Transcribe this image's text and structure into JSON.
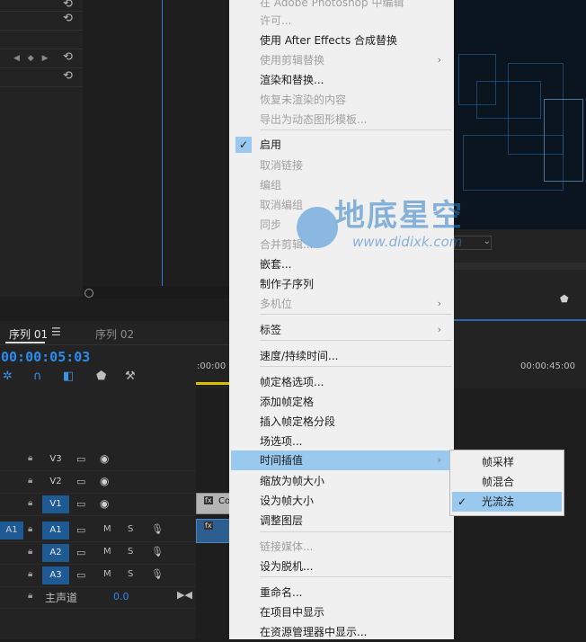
{
  "effect_controls": {
    "reset_glyph": "⟲",
    "keyframe_nav": "◀ ◆ ▶"
  },
  "monitor": {
    "zoom_value": "⌄",
    "marker_glyph": "⬟"
  },
  "timeline": {
    "tabs": [
      {
        "label": "序列 01"
      },
      {
        "label": "序列 02"
      }
    ],
    "tab_menu_glyph": "☰",
    "timecode": "00:00:05:03",
    "ruler": {
      "start": ":00:00",
      "mid": "00:00:45:00"
    },
    "tracks": {
      "video": [
        {
          "name": "V3",
          "enabled": false
        },
        {
          "name": "V2",
          "enabled": false
        },
        {
          "name": "V1",
          "enabled": true
        }
      ],
      "audio": [
        {
          "name": "A1",
          "source": "A1",
          "enabled": true
        },
        {
          "name": "A2",
          "source": "",
          "enabled": true
        },
        {
          "name": "A3",
          "source": "",
          "enabled": true
        }
      ],
      "mute_label": "M",
      "solo_label": "S"
    },
    "master": {
      "label": "主声道",
      "value": "0.0"
    },
    "clip_v1_label": "Co",
    "fx_badge": "fx"
  },
  "context_menu": {
    "items": [
      {
        "label": "在 Adobe Photoshop 中编辑",
        "disabled": true
      },
      {
        "label": "许可...",
        "disabled": true
      },
      {
        "label": "使用 After Effects 合成替换",
        "disabled": false
      },
      {
        "label": "使用剪辑替换",
        "disabled": true,
        "submenu": true
      },
      {
        "label": "渲染和替换...",
        "disabled": false
      },
      {
        "label": "恢复未渲染的内容",
        "disabled": true
      },
      {
        "label": "导出为动态图形模板...",
        "disabled": true
      },
      {
        "label": "启用",
        "disabled": false,
        "checked": true
      },
      {
        "label": "取消链接",
        "disabled": true
      },
      {
        "label": "编组",
        "disabled": true
      },
      {
        "label": "取消编组",
        "disabled": true
      },
      {
        "label": "同步",
        "disabled": true
      },
      {
        "label": "合并剪辑...",
        "disabled": true
      },
      {
        "label": "嵌套...",
        "disabled": false
      },
      {
        "label": "制作子序列",
        "disabled": false
      },
      {
        "label": "多机位",
        "disabled": true,
        "submenu": true
      },
      {
        "label": "标签",
        "disabled": false,
        "submenu": true
      },
      {
        "label": "速度/持续时间...",
        "disabled": false
      },
      {
        "label": "帧定格选项...",
        "disabled": false
      },
      {
        "label": "添加帧定格",
        "disabled": false
      },
      {
        "label": "插入帧定格分段",
        "disabled": false
      },
      {
        "label": "场选项...",
        "disabled": false
      },
      {
        "label": "时间插值",
        "disabled": false,
        "submenu": true,
        "highlighted": true
      },
      {
        "label": "缩放为帧大小",
        "disabled": false
      },
      {
        "label": "设为帧大小",
        "disabled": false
      },
      {
        "label": "调整图层",
        "disabled": false
      },
      {
        "label": "链接媒体...",
        "disabled": true
      },
      {
        "label": "设为脱机...",
        "disabled": false
      },
      {
        "label": "重命名...",
        "disabled": false
      },
      {
        "label": "在项目中显示",
        "disabled": false
      },
      {
        "label": "在资源管理器中显示...",
        "disabled": false
      }
    ],
    "arrow_glyph": "›",
    "check_glyph": "✓"
  },
  "submenu": {
    "items": [
      {
        "label": "帧采样",
        "checked": false
      },
      {
        "label": "帧混合",
        "checked": false
      },
      {
        "label": "光流法",
        "checked": true
      }
    ]
  },
  "watermark": {
    "title": "地底星空",
    "url": "www.didixk.com"
  },
  "colors": {
    "accent": "#2a8cf0",
    "menu_highlight": "#99c9ef",
    "track_on": "#1e5a94"
  }
}
